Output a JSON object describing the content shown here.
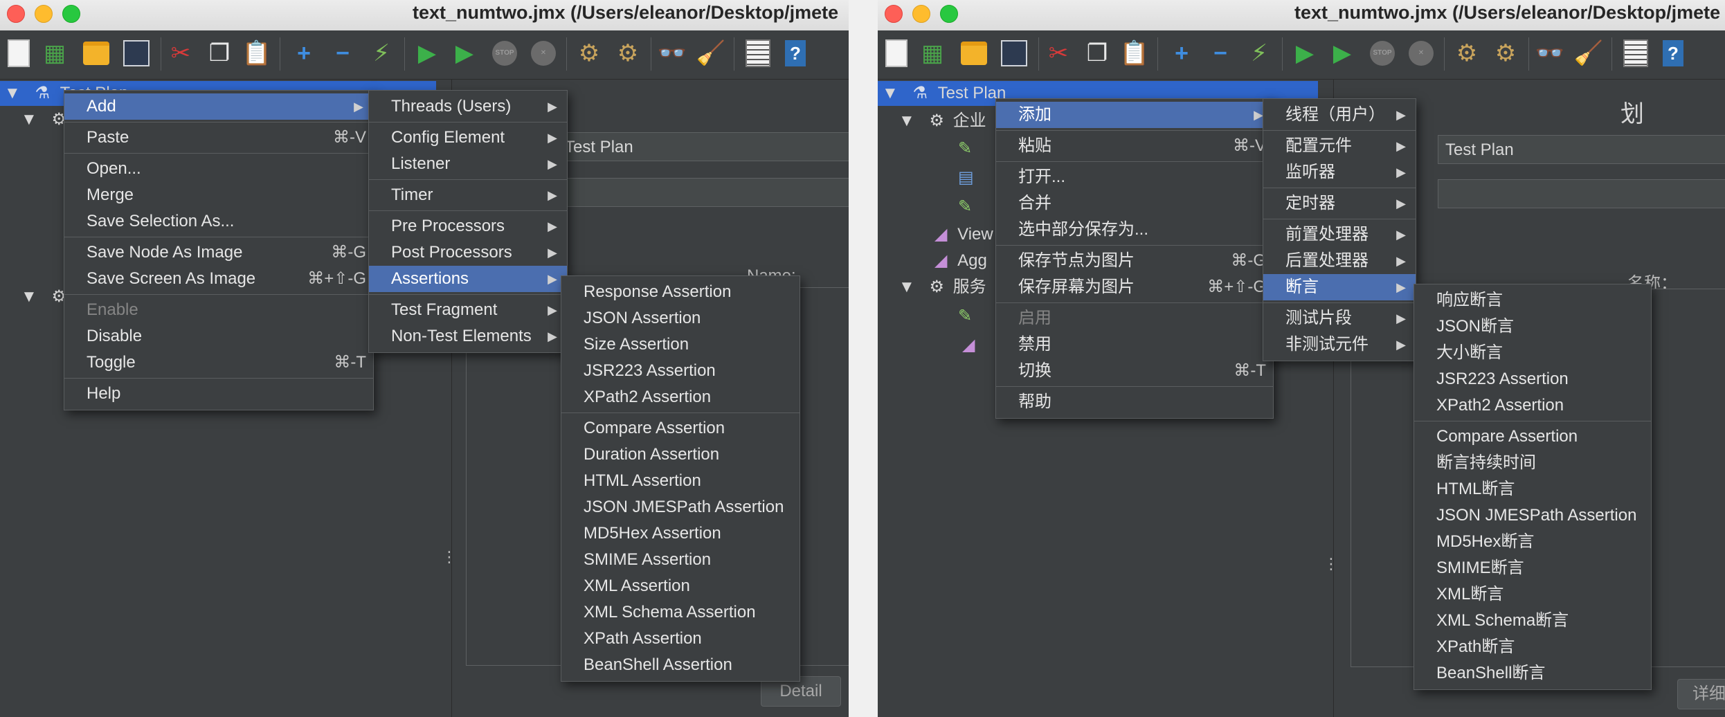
{
  "left": {
    "title": "text_numtwo.jmx (/Users/eleanor/Desktop/jmete",
    "tree": [
      "Test Plan"
    ],
    "form": {
      "name_value": "Test Plan",
      "name_label": "Name:",
      "detail_button": "Detail"
    },
    "menu1": [
      {
        "label": "Add",
        "arrow": true,
        "hl": true
      },
      {
        "sep": true
      },
      {
        "label": "Paste",
        "shortcut": "⌘-V"
      },
      {
        "sep": true
      },
      {
        "label": "Open..."
      },
      {
        "label": "Merge"
      },
      {
        "label": "Save Selection As..."
      },
      {
        "sep": true
      },
      {
        "label": "Save Node As Image",
        "shortcut": "⌘-G"
      },
      {
        "label": "Save Screen As Image",
        "shortcut": "⌘+⇧-G"
      },
      {
        "sep": true
      },
      {
        "label": "Enable",
        "disabled": true
      },
      {
        "label": "Disable"
      },
      {
        "label": "Toggle",
        "shortcut": "⌘-T"
      },
      {
        "sep": true
      },
      {
        "label": "Help"
      }
    ],
    "menu2": [
      {
        "label": "Threads (Users)",
        "arrow": true
      },
      {
        "sep": true
      },
      {
        "label": "Config Element",
        "arrow": true
      },
      {
        "label": "Listener",
        "arrow": true
      },
      {
        "sep": true
      },
      {
        "label": "Timer",
        "arrow": true
      },
      {
        "sep": true
      },
      {
        "label": "Pre Processors",
        "arrow": true
      },
      {
        "label": "Post Processors",
        "arrow": true
      },
      {
        "label": "Assertions",
        "arrow": true,
        "hl": true
      },
      {
        "sep": true
      },
      {
        "label": "Test Fragment",
        "arrow": true
      },
      {
        "label": "Non-Test Elements",
        "arrow": true
      }
    ],
    "menu3": [
      {
        "label": "Response Assertion"
      },
      {
        "label": "JSON Assertion"
      },
      {
        "label": "Size Assertion"
      },
      {
        "label": "JSR223 Assertion"
      },
      {
        "label": "XPath2 Assertion"
      },
      {
        "sep": true
      },
      {
        "label": "Compare Assertion"
      },
      {
        "label": "Duration Assertion"
      },
      {
        "label": "HTML Assertion"
      },
      {
        "label": "JSON JMESPath Assertion"
      },
      {
        "label": "MD5Hex Assertion"
      },
      {
        "label": "SMIME Assertion"
      },
      {
        "label": "XML Assertion"
      },
      {
        "label": "XML Schema Assertion"
      },
      {
        "label": "XPath Assertion"
      },
      {
        "label": "BeanShell Assertion"
      }
    ]
  },
  "right": {
    "title": "text_numtwo.jmx (/Users/eleanor/Desktop/jmete",
    "tree": [
      "Test Plan",
      "企业",
      "View",
      "Agg",
      "服务"
    ],
    "form": {
      "name_value": "Test Plan",
      "name_label": "名称：",
      "heading": "划",
      "detail_button": "详细"
    },
    "menu1": [
      {
        "label": "添加",
        "arrow": true,
        "hl": true
      },
      {
        "sep": true
      },
      {
        "label": "粘贴",
        "shortcut": "⌘-V"
      },
      {
        "sep": true
      },
      {
        "label": "打开..."
      },
      {
        "label": "合并"
      },
      {
        "label": "选中部分保存为..."
      },
      {
        "sep": true
      },
      {
        "label": "保存节点为图片",
        "shortcut": "⌘-G"
      },
      {
        "label": "保存屏幕为图片",
        "shortcut": "⌘+⇧-G"
      },
      {
        "sep": true
      },
      {
        "label": "启用",
        "disabled": true
      },
      {
        "label": "禁用"
      },
      {
        "label": "切换",
        "shortcut": "⌘-T"
      },
      {
        "sep": true
      },
      {
        "label": "帮助"
      }
    ],
    "menu2": [
      {
        "label": "线程（用户）",
        "arrow": true
      },
      {
        "sep": true
      },
      {
        "label": "配置元件",
        "arrow": true
      },
      {
        "label": "监听器",
        "arrow": true
      },
      {
        "sep": true
      },
      {
        "label": "定时器",
        "arrow": true
      },
      {
        "sep": true
      },
      {
        "label": "前置处理器",
        "arrow": true
      },
      {
        "label": "后置处理器",
        "arrow": true
      },
      {
        "label": "断言",
        "arrow": true,
        "hl": true
      },
      {
        "sep": true
      },
      {
        "label": "测试片段",
        "arrow": true
      },
      {
        "label": "非测试元件",
        "arrow": true
      }
    ],
    "menu3": [
      {
        "label": "响应断言"
      },
      {
        "label": "JSON断言"
      },
      {
        "label": "大小断言"
      },
      {
        "label": "JSR223 Assertion"
      },
      {
        "label": "XPath2 Assertion"
      },
      {
        "sep": true
      },
      {
        "label": "Compare Assertion"
      },
      {
        "label": "断言持续时间"
      },
      {
        "label": "HTML断言"
      },
      {
        "label": "JSON JMESPath Assertion"
      },
      {
        "label": "MD5Hex断言"
      },
      {
        "label": "SMIME断言"
      },
      {
        "label": "XML断言"
      },
      {
        "label": "XML Schema断言"
      },
      {
        "label": "XPath断言"
      },
      {
        "label": "BeanShell断言"
      }
    ]
  },
  "toolbar_icons": [
    "new-icon",
    "templates-icon",
    "open-icon",
    "save-icon",
    "cut-icon",
    "copy-icon",
    "paste-icon",
    "expand-icon",
    "collapse-icon",
    "toggle-icon",
    "start-icon",
    "start-no-pauses-icon",
    "stop-icon",
    "shutdown-icon",
    "clear-icon",
    "clear-all-icon",
    "search-icon",
    "reset-search-icon",
    "function-helper-icon",
    "help-icon"
  ]
}
